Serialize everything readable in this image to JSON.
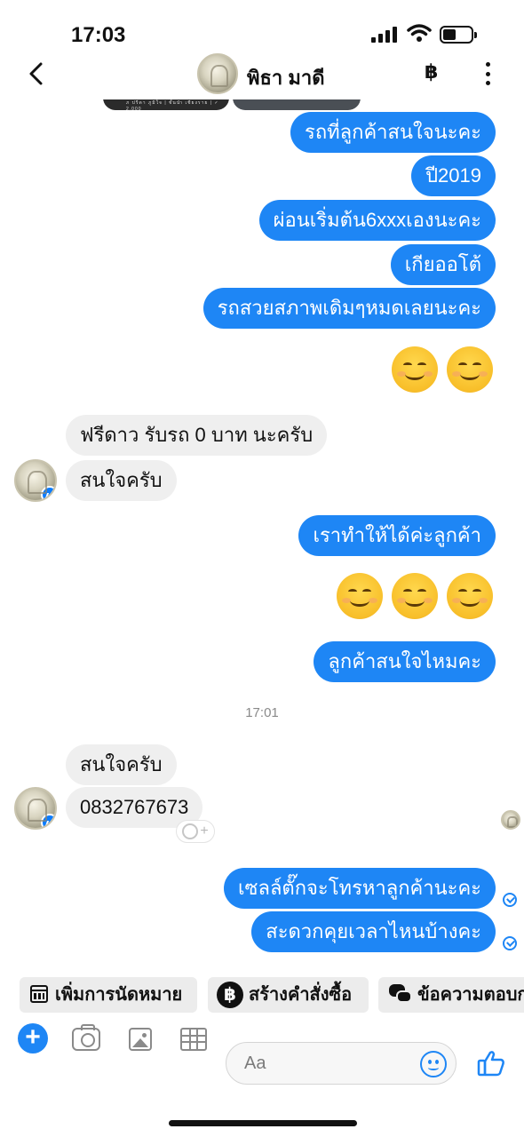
{
  "status_bar": {
    "time": "17:03"
  },
  "header": {
    "contact_name": "พิธา มาดี",
    "currency_symbol": "฿"
  },
  "partial_image": {
    "caption": "ภ ปรีดา ภูมิใจ  |  ชั้นนำ เชียงราย  |  ✓ 2,000"
  },
  "messages": {
    "m1": "รถที่ลูกค้าสนใจนะคะ",
    "m2": "ปี2019",
    "m3": "ผ่อนเริ่มต้น6xxxเองนะคะ",
    "m4": "เกียออโต้",
    "m5": "รถสวยสภาพเดิมๆหมดเลยนะคะ",
    "m6": "ฟรีดาว รับรถ 0 บาท นะครับ",
    "m7": "สนใจครับ",
    "m8": "เราทำให้ได้ค่ะลูกค้า",
    "m9": "ลูกค้าสนใจไหมคะ",
    "m10": "สนใจครับ",
    "m11": "0832767673",
    "m12": "เซลล์ตั๊กจะโทรหาลูกค้านะคะ",
    "m13": "สะดวกคุยเวลาไหนบ้างคะ"
  },
  "timestamp": "17:01",
  "quick_actions": {
    "appointment": "เพิ่มการนัดหมาย",
    "order": "สร้างคำสั่งซื้อ",
    "order_icon": "฿",
    "replies": "ข้อความตอบก"
  },
  "composer": {
    "placeholder": "Aa"
  },
  "icons": [
    "back-chevron-icon",
    "baht-icon",
    "more-icon",
    "messenger-badge-icon",
    "plus-icon",
    "camera-icon",
    "gallery-icon",
    "table-icon",
    "emoji-icon",
    "like-icon",
    "calendar-icon",
    "chat-bubbles-icon"
  ],
  "colors": {
    "outgoing_bubble": "#1e86f5",
    "incoming_bubble": "#efefef",
    "accent": "#1e86f5"
  }
}
